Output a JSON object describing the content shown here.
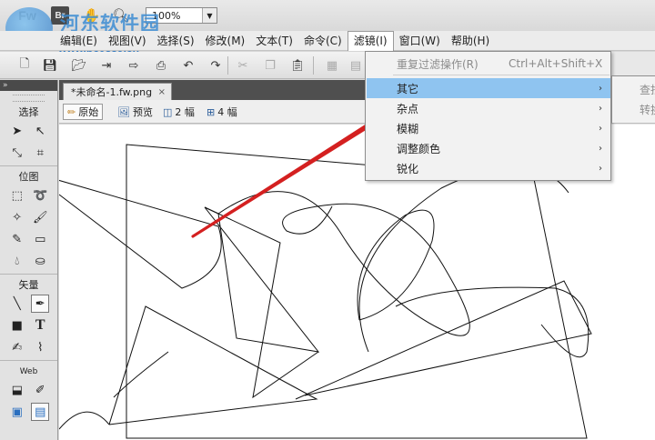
{
  "window": {
    "app_logo": "Fw",
    "bridge_icon": "Br",
    "zoom_value": "100%"
  },
  "watermark": {
    "line1": "河东软件园",
    "line2": "www.pc0359.cn"
  },
  "menubar": {
    "items": [
      {
        "label": "编辑(E)"
      },
      {
        "label": "视图(V)"
      },
      {
        "label": "选择(S)"
      },
      {
        "label": "修改(M)"
      },
      {
        "label": "文本(T)"
      },
      {
        "label": "命令(C)"
      },
      {
        "label": "滤镜(I)"
      },
      {
        "label": "窗口(W)"
      },
      {
        "label": "帮助(H)"
      }
    ],
    "active_index": 6
  },
  "toolbar": {
    "icons": [
      "new-file-icon",
      "save-icon",
      "open-folder-icon",
      "import-icon",
      "export-icon",
      "print-icon",
      "undo-icon",
      "redo-icon",
      "cut-icon",
      "copy-icon",
      "paste-icon",
      "group-icon",
      "ungroup-icon"
    ]
  },
  "tools_panel": {
    "sections": [
      {
        "label": "选择"
      },
      {
        "label": "位图"
      },
      {
        "label": "矢量"
      },
      {
        "label": "Web"
      }
    ]
  },
  "document": {
    "tab_label": "*未命名-1.fw.png",
    "close_glyph": "×",
    "view_buttons": [
      {
        "label": "原始",
        "active": true,
        "icon": "pencil-icon"
      },
      {
        "label": "预览",
        "active": false,
        "icon": "image-icon"
      },
      {
        "label": "2 幅",
        "active": false,
        "icon": "two-up-icon"
      },
      {
        "label": "4 幅",
        "active": false,
        "icon": "four-up-icon"
      }
    ]
  },
  "filters_menu": {
    "items": [
      {
        "label": "重复过滤操作(R)",
        "shortcut": "Ctrl+Alt+Shift+X",
        "disabled": true,
        "submenu": false
      },
      {
        "label": "其它",
        "shortcut": "",
        "disabled": false,
        "submenu": true,
        "highlighted": true
      },
      {
        "label": "杂点",
        "shortcut": "",
        "disabled": false,
        "submenu": true
      },
      {
        "label": "模糊",
        "shortcut": "",
        "disabled": false,
        "submenu": true
      },
      {
        "label": "调整颜色",
        "shortcut": "",
        "disabled": false,
        "submenu": true
      },
      {
        "label": "锐化",
        "shortcut": "",
        "disabled": false,
        "submenu": true
      }
    ],
    "submenu_arrow": "›",
    "highlight_color": "#8fc4f0"
  },
  "submenu": {
    "items": [
      {
        "label": "查找"
      },
      {
        "label": "转换"
      }
    ]
  },
  "colors": {
    "annotation_arrow": "#d42020",
    "menu_highlight": "#8fc4f0"
  }
}
